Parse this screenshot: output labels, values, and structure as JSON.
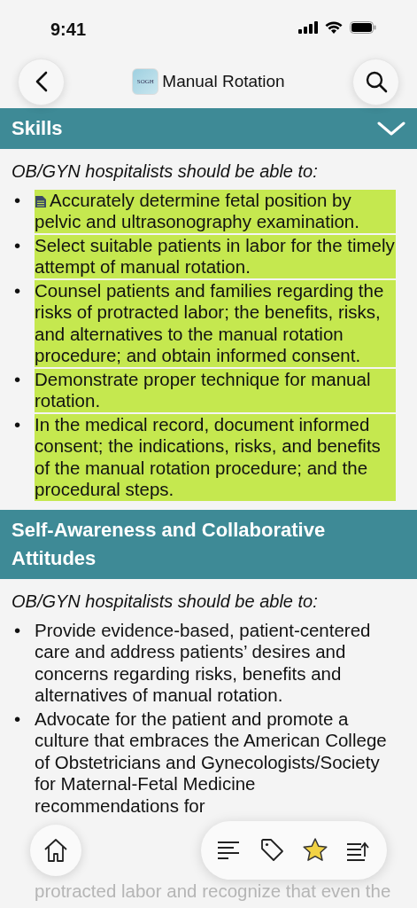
{
  "status_bar": {
    "time": "9:41"
  },
  "nav": {
    "title": "Manual Rotation",
    "logo_text": "SOGH"
  },
  "sections": [
    {
      "title": "Skills",
      "expanded": true,
      "intro": "OB/GYN hospitalists should be able to:",
      "items": [
        {
          "marker": "•",
          "text": "Accurately determine fetal position by pelvic and ultrasonography examination.",
          "highlighted": true,
          "note": true
        },
        {
          "marker": "•",
          "text": "Select suitable patients in labor for the timely attempt of manual rotation.",
          "highlighted": true
        },
        {
          "marker": "•",
          "text": "Counsel patients and families regarding the risks of protracted labor; the benefits, risks, and alternatives to the manual rotation procedure; and obtain informed consent.",
          "highlighted": true
        },
        {
          "marker": "•",
          "text": "Demonstrate proper technique for manual rotation.",
          "highlighted": true
        },
        {
          "marker": "•",
          "text": "In the medical record, document informed consent; the indications, risks, and benefits of the manual rotation procedure; and the procedural steps.",
          "highlighted": true
        }
      ]
    },
    {
      "title": "Self-Awareness and Collaborative Attitudes",
      "intro": "OB/GYN hospitalists should be able to:",
      "items": [
        {
          "marker": "•",
          "text": "Provide evidence-based, patient-centered care and address patients’ desires and concerns regarding risks, benefits and alternatives of manual rotation.",
          "highlighted": false
        },
        {
          "marker": "•",
          "text": "Advocate for the patient and promote a culture that embraces the American College of Obstetricians and Gynecologists/Society for Maternal-Fetal Medicine recommendations for",
          "highlighted": false
        }
      ],
      "continuation": "protracted labor and recognize that even the"
    }
  ],
  "toolbar": [
    {
      "kind": "list"
    },
    {
      "kind": "tag"
    },
    {
      "kind": "star",
      "on": true
    },
    {
      "kind": "export"
    }
  ]
}
